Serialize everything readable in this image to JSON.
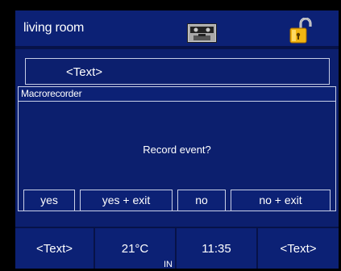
{
  "header": {
    "title": "living room",
    "icons": [
      "cassette-icon",
      "unlock-icon"
    ]
  },
  "background_field": {
    "text": "<Text>"
  },
  "dialog": {
    "title": "Macrorecorder",
    "message": "Record event?",
    "buttons": [
      "yes",
      "yes + exit",
      "no",
      "no + exit"
    ]
  },
  "footer": {
    "cells": [
      {
        "text": "<Text>"
      },
      {
        "text": "21°C",
        "sub": "IN"
      },
      {
        "text": "11:35"
      },
      {
        "text": "<Text>"
      }
    ]
  },
  "colors": {
    "background": "#0c1f6e",
    "bezel": "#000000",
    "text": "#ffffff",
    "lock": "#f2b511"
  }
}
